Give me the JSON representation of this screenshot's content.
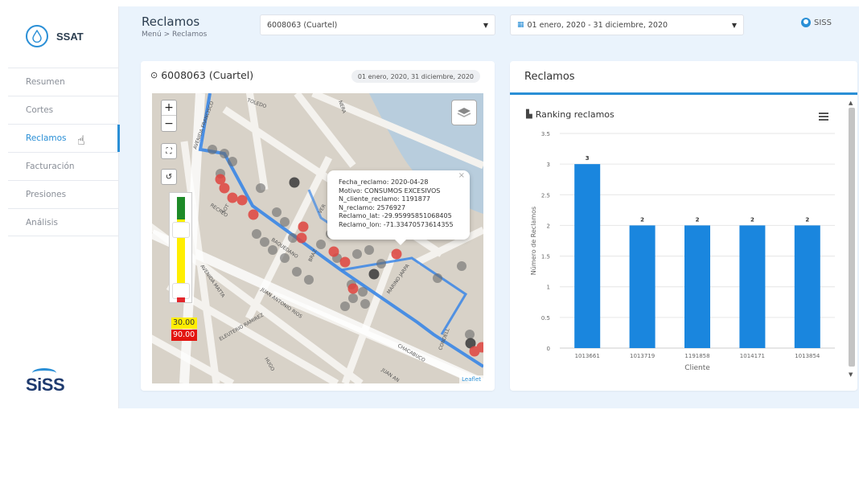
{
  "sidebar": {
    "logo_text": "SSAT",
    "items": [
      {
        "label": "Resumen"
      },
      {
        "label": "Cortes"
      },
      {
        "label": "Reclamos"
      },
      {
        "label": "Facturación"
      },
      {
        "label": "Presiones"
      },
      {
        "label": "Análisis"
      }
    ],
    "active_item": "Reclamos",
    "footer_logo": "SiSS"
  },
  "header": {
    "title": "Reclamos",
    "breadcrumb": "Menú > Reclamos",
    "client_select": "6008063 (Cuartel)",
    "date_select": "01 enero, 2020 - 31 diciembre, 2020",
    "user": "SISS"
  },
  "map_card": {
    "title": "6008063 (Cuartel)",
    "date_range": "01 enero, 2020, 31 diciembre, 2020",
    "legend_yellow": "30.00",
    "legend_red": "90.00",
    "attribution": "Leaflet",
    "popup": {
      "fecha": "Fecha_reclamo: 2020-04-28",
      "motivo": "Motivo: CONSUMOS EXCESIVOS",
      "cliente": "N_cliente_reclamo: 1191877",
      "reclamo": "N_reclamo: 2576927",
      "lat": "Reclamo_lat: -29.95995851068405",
      "lon": "Reclamo_lon: -71.33470573614355"
    },
    "street_labels": [
      "AVENIDA FRANCISCO",
      "BAQUEDANO",
      "JUAN ANTONIO RIOS",
      "AVENIDA MATTA",
      "ELEUTERIO RAMIREZ",
      "MARINO JARPA",
      "CHACABUCO",
      "RECREO",
      "HUGO",
      "JUAN AN",
      "CONDELL",
      "BRAZ",
      "TOLEDO",
      "NERA",
      "VER",
      "SOT"
    ]
  },
  "chart_card": {
    "header": "Reclamos",
    "subtitle": "Ranking reclamos"
  },
  "chart_data": {
    "type": "bar",
    "categories": [
      "1013661",
      "1013719",
      "1191858",
      "1014171",
      "1013854"
    ],
    "values": [
      3,
      2,
      2,
      2,
      2
    ],
    "xlabel": "Cliente",
    "ylabel": "Número de Reclamos",
    "ylim": [
      0,
      3.5
    ],
    "yticks": [
      "0",
      "0.5",
      "1",
      "1.5",
      "2",
      "2.5",
      "3",
      "3.5"
    ],
    "bar_color": "#1a86de"
  }
}
